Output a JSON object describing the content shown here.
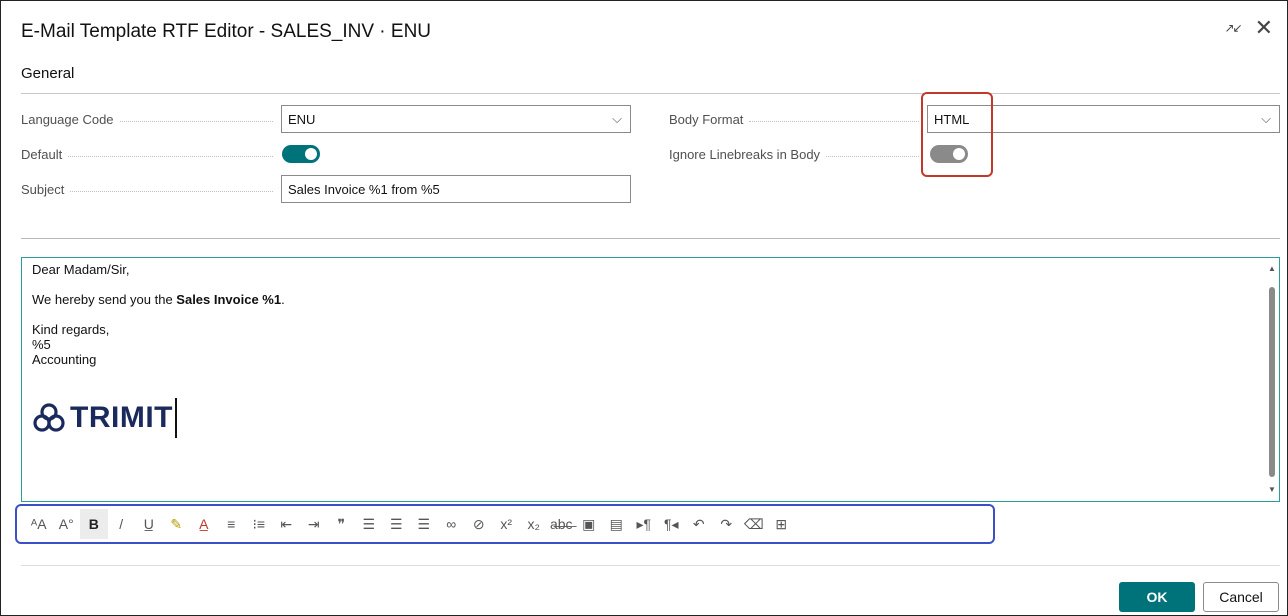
{
  "window": {
    "title": "E-Mail Template RTF Editor - SALES_INV · ENU"
  },
  "section": {
    "title": "General"
  },
  "fields": {
    "language_code": {
      "label": "Language Code",
      "value": "ENU"
    },
    "default": {
      "label": "Default",
      "on": true
    },
    "subject": {
      "label": "Subject",
      "value": "Sales Invoice %1 from %5"
    },
    "body_format": {
      "label": "Body Format",
      "value": "HTML"
    },
    "ignore_linebreaks": {
      "label": "Ignore Linebreaks in Body",
      "on": true,
      "disabled": true
    }
  },
  "body": {
    "greeting": "Dear Madam/Sir,",
    "line_prefix": "We hereby send you the ",
    "line_bold": "Sales Invoice %1",
    "line_suffix": ".",
    "closing": "Kind regards,",
    "sender": "%5",
    "department": "Accounting",
    "logo_text": "TRIMIT"
  },
  "toolbar": {
    "items": [
      {
        "name": "font-size-decrease-icon",
        "glyph": "ᴬA"
      },
      {
        "name": "font-size-increase-icon",
        "glyph": "A°"
      },
      {
        "name": "bold-icon",
        "glyph": "B"
      },
      {
        "name": "italic-icon",
        "glyph": "/"
      },
      {
        "name": "underline-icon",
        "glyph": "U̲"
      },
      {
        "name": "highlight-icon",
        "glyph": "✎"
      },
      {
        "name": "font-color-icon",
        "glyph": "A̲"
      },
      {
        "name": "bullet-list-icon",
        "glyph": "≡"
      },
      {
        "name": "numbered-list-icon",
        "glyph": "⁝≡"
      },
      {
        "name": "outdent-icon",
        "glyph": "⇤"
      },
      {
        "name": "indent-icon",
        "glyph": "⇥"
      },
      {
        "name": "quote-icon",
        "glyph": "❞"
      },
      {
        "name": "align-left-icon",
        "glyph": "☰"
      },
      {
        "name": "align-center-icon",
        "glyph": "☰"
      },
      {
        "name": "align-right-icon",
        "glyph": "☰"
      },
      {
        "name": "link-icon",
        "glyph": "∞"
      },
      {
        "name": "unlink-icon",
        "glyph": "⊘"
      },
      {
        "name": "superscript-icon",
        "glyph": "x²"
      },
      {
        "name": "subscript-icon",
        "glyph": "x₂"
      },
      {
        "name": "strikethrough-icon",
        "glyph": "a̶b̶c̶"
      },
      {
        "name": "insert-image-icon",
        "glyph": "▣"
      },
      {
        "name": "image-properties-icon",
        "glyph": "▤"
      },
      {
        "name": "ltr-direction-icon",
        "glyph": "▸¶"
      },
      {
        "name": "rtl-direction-icon",
        "glyph": "¶◂"
      },
      {
        "name": "undo-icon",
        "glyph": "↶"
      },
      {
        "name": "redo-icon",
        "glyph": "↷"
      },
      {
        "name": "clear-formatting-icon",
        "glyph": "⌫"
      },
      {
        "name": "insert-table-icon",
        "glyph": "⊞"
      }
    ]
  },
  "buttons": {
    "ok": "OK",
    "cancel": "Cancel"
  },
  "colors": {
    "accent": "#00727a",
    "toggle_on": "#00727a",
    "toggle_disabled": "#8a8a8a",
    "highlight_red": "#c0392b",
    "highlight_blue": "#3b50c8"
  }
}
